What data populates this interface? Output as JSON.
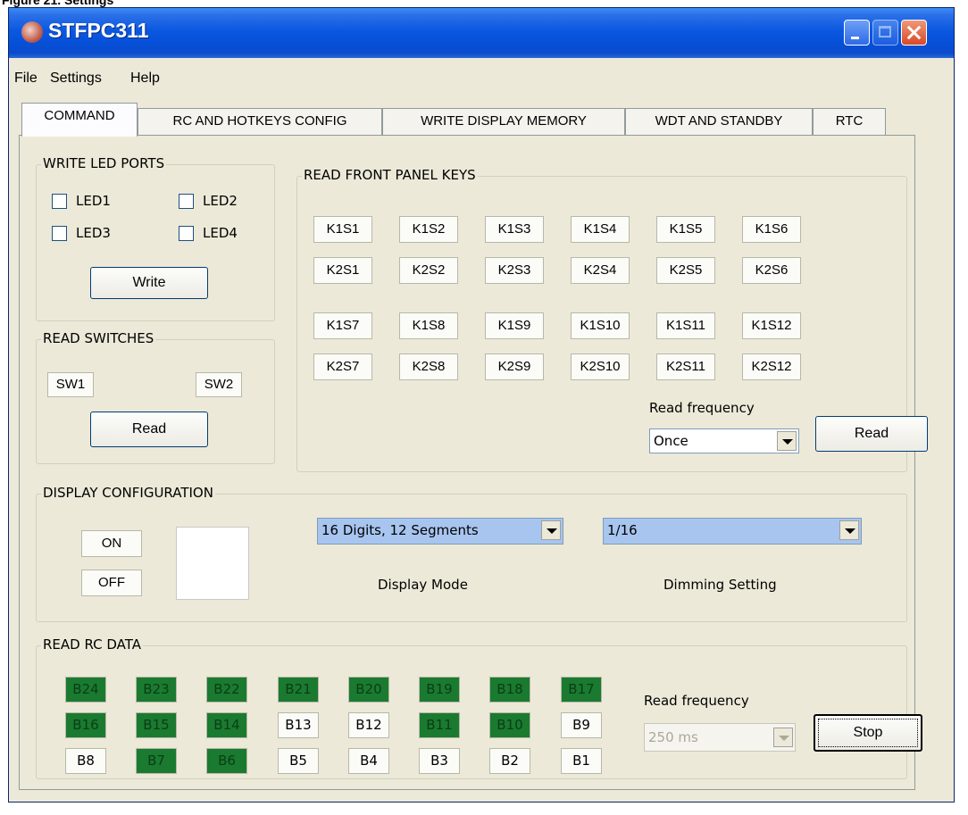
{
  "caption": "Figure 21. Settings",
  "window": {
    "title": "STFPC311",
    "menu": [
      "File",
      "Settings",
      "Help"
    ],
    "tabs": [
      "COMMAND",
      "RC AND HOTKEYS CONFIG",
      "WRITE DISPLAY MEMORY",
      "WDT AND STANDBY",
      "RTC"
    ],
    "active_tab": "COMMAND"
  },
  "write_led": {
    "title": "WRITE LED PORTS",
    "leds": [
      "LED1",
      "LED2",
      "LED3",
      "LED4"
    ],
    "button": "Write"
  },
  "read_switches": {
    "title": "READ SWITCHES",
    "switches": [
      "SW1",
      "SW2"
    ],
    "button": "Read"
  },
  "front_panel": {
    "title": "READ FRONT PANEL KEYS",
    "keys": [
      [
        "K1S1",
        "K1S2",
        "K1S3",
        "K1S4",
        "K1S5",
        "K1S6"
      ],
      [
        "K2S1",
        "K2S2",
        "K2S3",
        "K2S4",
        "K2S5",
        "K2S6"
      ],
      [
        "K1S7",
        "K1S8",
        "K1S9",
        "K1S10",
        "K1S11",
        "K1S12"
      ],
      [
        "K2S7",
        "K2S8",
        "K2S9",
        "K2S10",
        "K2S11",
        "K2S12"
      ]
    ],
    "freq_label": "Read frequency",
    "freq_value": "Once",
    "button": "Read"
  },
  "display_config": {
    "title": "DISPLAY CONFIGURATION",
    "on": "ON",
    "off": "OFF",
    "mode_value": "16 Digits, 12 Segments",
    "mode_label": "Display Mode",
    "dim_value": "1/16",
    "dim_label": "Dimming Setting"
  },
  "rc_data": {
    "title": "READ RC DATA",
    "rows": [
      [
        {
          "label": "B24",
          "on": true
        },
        {
          "label": "B23",
          "on": true
        },
        {
          "label": "B22",
          "on": true
        },
        {
          "label": "B21",
          "on": true
        },
        {
          "label": "B20",
          "on": true
        },
        {
          "label": "B19",
          "on": true
        },
        {
          "label": "B18",
          "on": true
        },
        {
          "label": "B17",
          "on": true
        }
      ],
      [
        {
          "label": "B16",
          "on": true
        },
        {
          "label": "B15",
          "on": true
        },
        {
          "label": "B14",
          "on": true
        },
        {
          "label": "B13",
          "on": false
        },
        {
          "label": "B12",
          "on": false
        },
        {
          "label": "B11",
          "on": true
        },
        {
          "label": "B10",
          "on": true
        },
        {
          "label": "B9",
          "on": false
        }
      ],
      [
        {
          "label": "B8",
          "on": false
        },
        {
          "label": "B7",
          "on": true
        },
        {
          "label": "B6",
          "on": true
        },
        {
          "label": "B5",
          "on": false
        },
        {
          "label": "B4",
          "on": false
        },
        {
          "label": "B3",
          "on": false
        },
        {
          "label": "B2",
          "on": false
        },
        {
          "label": "B1",
          "on": false
        }
      ]
    ],
    "freq_label": "Read frequency",
    "freq_value": "250 ms",
    "button": "Stop"
  },
  "colors": {
    "rc_on": "#1a7a30",
    "titlebar": "#0b58e0"
  }
}
